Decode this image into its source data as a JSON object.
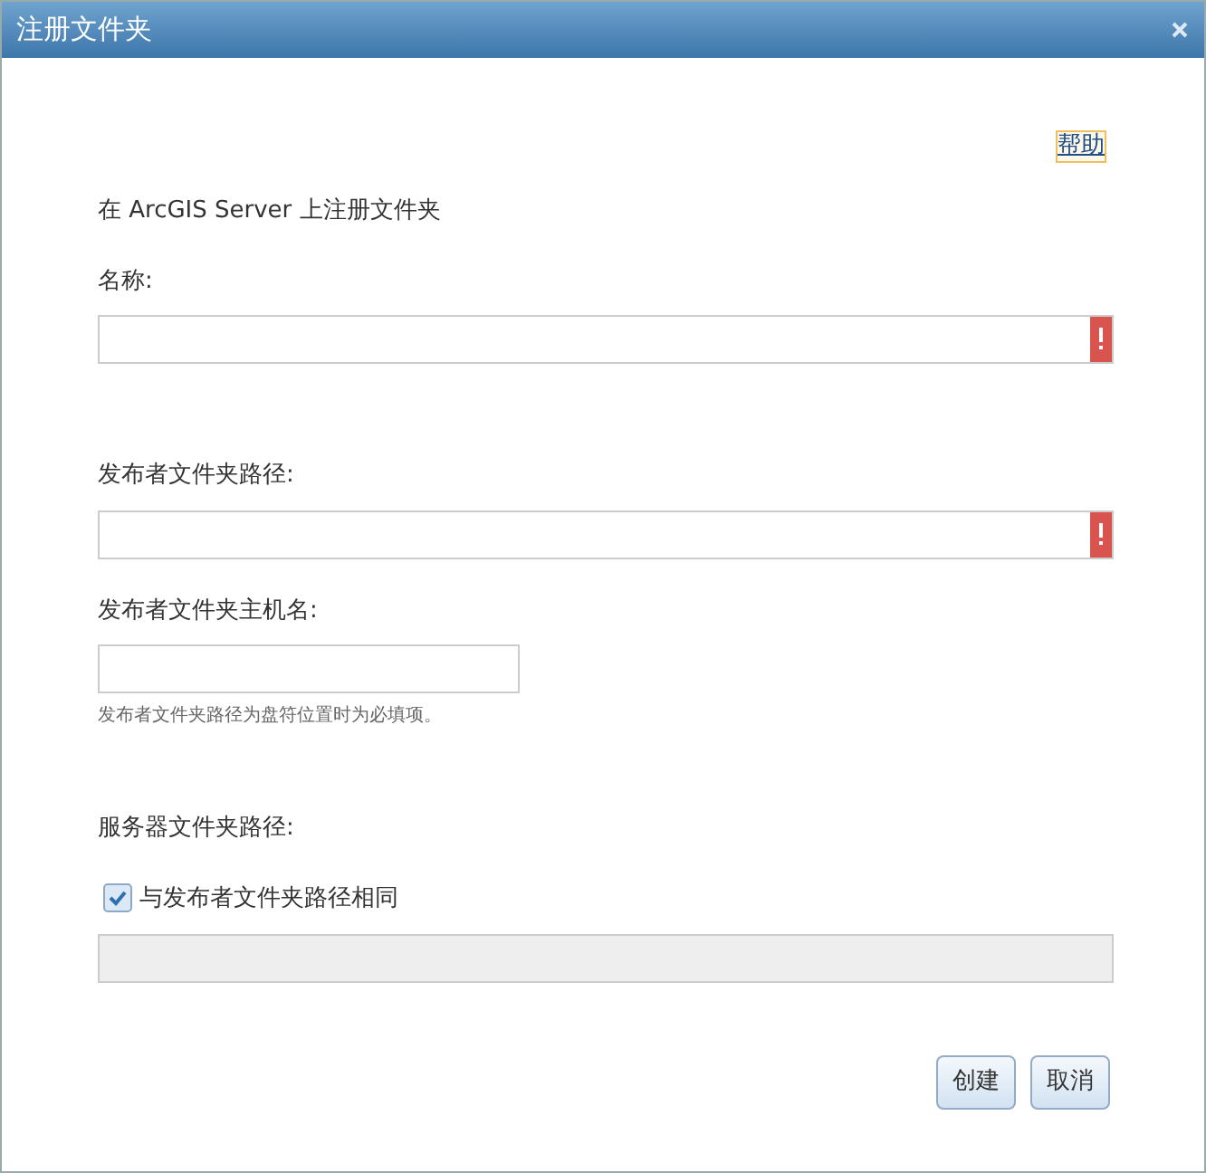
{
  "window": {
    "title": "注册文件夹",
    "closable": true
  },
  "help_link": "帮助",
  "intro": "在 ArcGIS Server 上注册文件夹",
  "fields": [
    {
      "kind": "text",
      "label": "名称:",
      "error": true
    },
    {
      "kind": "text",
      "label": "发布者文件夹路径:",
      "error": true
    },
    {
      "kind": "short",
      "label": "发布者文件夹主机名:",
      "hint": "发布者文件夹路径为盘符位置时为必填项。"
    },
    {
      "kind": "checkbox-text",
      "label": "服务器文件夹路径:",
      "checkbox": {
        "label": "与发布者文件夹路径相同",
        "checked": true
      },
      "disabled": true
    }
  ],
  "buttons": [
    "创建",
    "取消"
  ]
}
